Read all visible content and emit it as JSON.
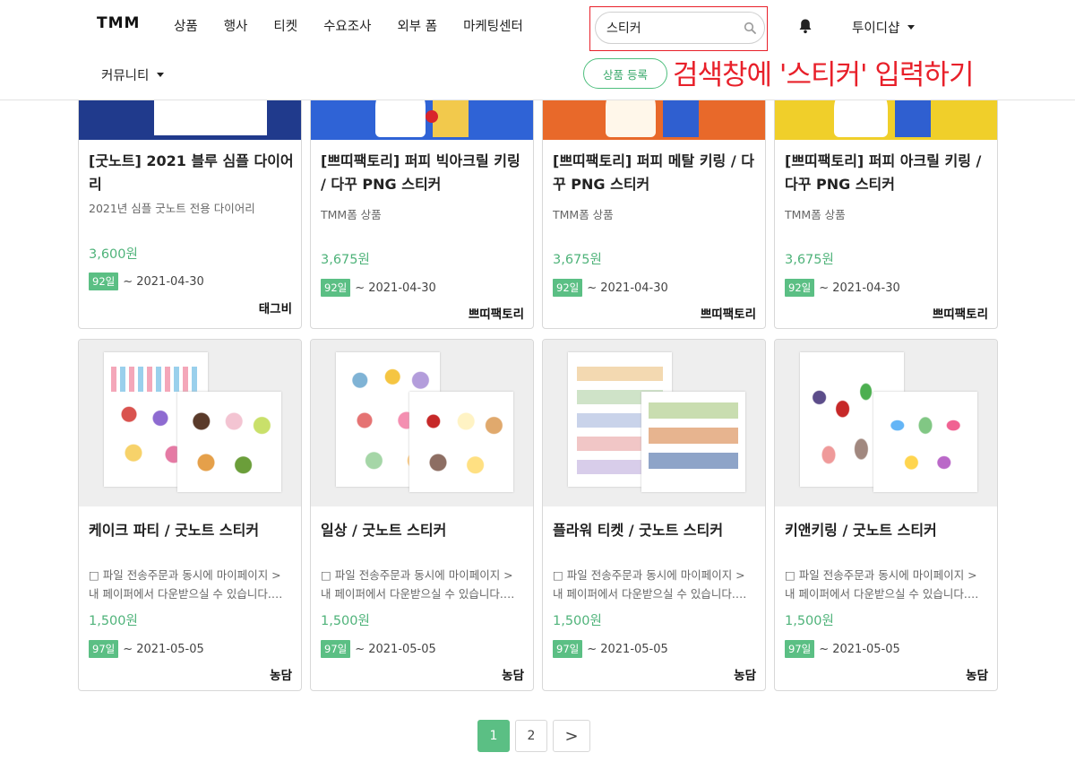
{
  "header": {
    "logo": "TMM",
    "nav": [
      "상품",
      "행사",
      "티켓",
      "수요조사",
      "외부 폼",
      "마케팅센터"
    ],
    "nav_row2": "커뮤니티",
    "search": {
      "value": "스티커",
      "placeholder": ""
    },
    "user": "투이디샵",
    "register_button": "상품 등록",
    "annotation": "검색창에 '스티커' 입력하기",
    "accent_color": "#5bbf84",
    "highlight_color": "#e8202a"
  },
  "products_top": [
    {
      "title": "[굿노트] 2021 블루 심플 다이어리",
      "desc": "2021년 심플 굿노트 전용 다이어리",
      "price": "3,600원",
      "days": "92일",
      "date": "~ 2021-04-30",
      "seller": "태그비",
      "thumb_color": "#203a8c"
    },
    {
      "title": "[쁘띠팩토리] 퍼피 빅아크릴 키링 / 다꾸 PNG 스티커",
      "desc": "TMM폼 상품",
      "price": "3,675원",
      "days": "92일",
      "date": "~ 2021-04-30",
      "seller": "쁘띠팩토리",
      "thumb_color": "#2f63d6"
    },
    {
      "title": "[쁘띠팩토리] 퍼피 메탈 키링 / 다꾸 PNG 스티커",
      "desc": "TMM폼 상품",
      "price": "3,675원",
      "days": "92일",
      "date": "~ 2021-04-30",
      "seller": "쁘띠팩토리",
      "thumb_color": "#e8692a"
    },
    {
      "title": "[쁘띠팩토리] 퍼피 아크릴 키링 / 다꾸 PNG 스티커",
      "desc": "TMM폼 상품",
      "price": "3,675원",
      "days": "92일",
      "date": "~ 2021-04-30",
      "seller": "쁘띠팩토리",
      "thumb_color": "#f0cf2a"
    }
  ],
  "products_bottom": [
    {
      "title": "케이크 파티 / 굿노트 스티커",
      "desc": "□ 파일 전송주문과 동시에 마이페이지 > 내 페이퍼에서 다운받으실 수 있습니다.…",
      "price": "1,500원",
      "days": "97일",
      "date": "~ 2021-05-05",
      "seller": "농담",
      "thumb_color": "#f2f2f2"
    },
    {
      "title": "일상 / 굿노트 스티커",
      "desc": "□ 파일 전송주문과 동시에 마이페이지 > 내 페이퍼에서 다운받으실 수 있습니다.…",
      "price": "1,500원",
      "days": "97일",
      "date": "~ 2021-05-05",
      "seller": "농담",
      "thumb_color": "#f2f2f2"
    },
    {
      "title": "플라워 티켓 / 굿노트 스티커",
      "desc": "□ 파일 전송주문과 동시에 마이페이지 > 내 페이퍼에서 다운받으실 수 있습니다.…",
      "price": "1,500원",
      "days": "97일",
      "date": "~ 2021-05-05",
      "seller": "농담",
      "thumb_color": "#f2f2f2"
    },
    {
      "title": "키앤키링 / 굿노트 스티커",
      "desc": "□ 파일 전송주문과 동시에 마이페이지 > 내 페이퍼에서 다운받으실 수 있습니다.…",
      "price": "1,500원",
      "days": "97일",
      "date": "~ 2021-05-05",
      "seller": "농담",
      "thumb_color": "#f2f2f2"
    }
  ],
  "pagination": {
    "pages": [
      "1",
      "2"
    ],
    "current": "1",
    "next": ">"
  }
}
